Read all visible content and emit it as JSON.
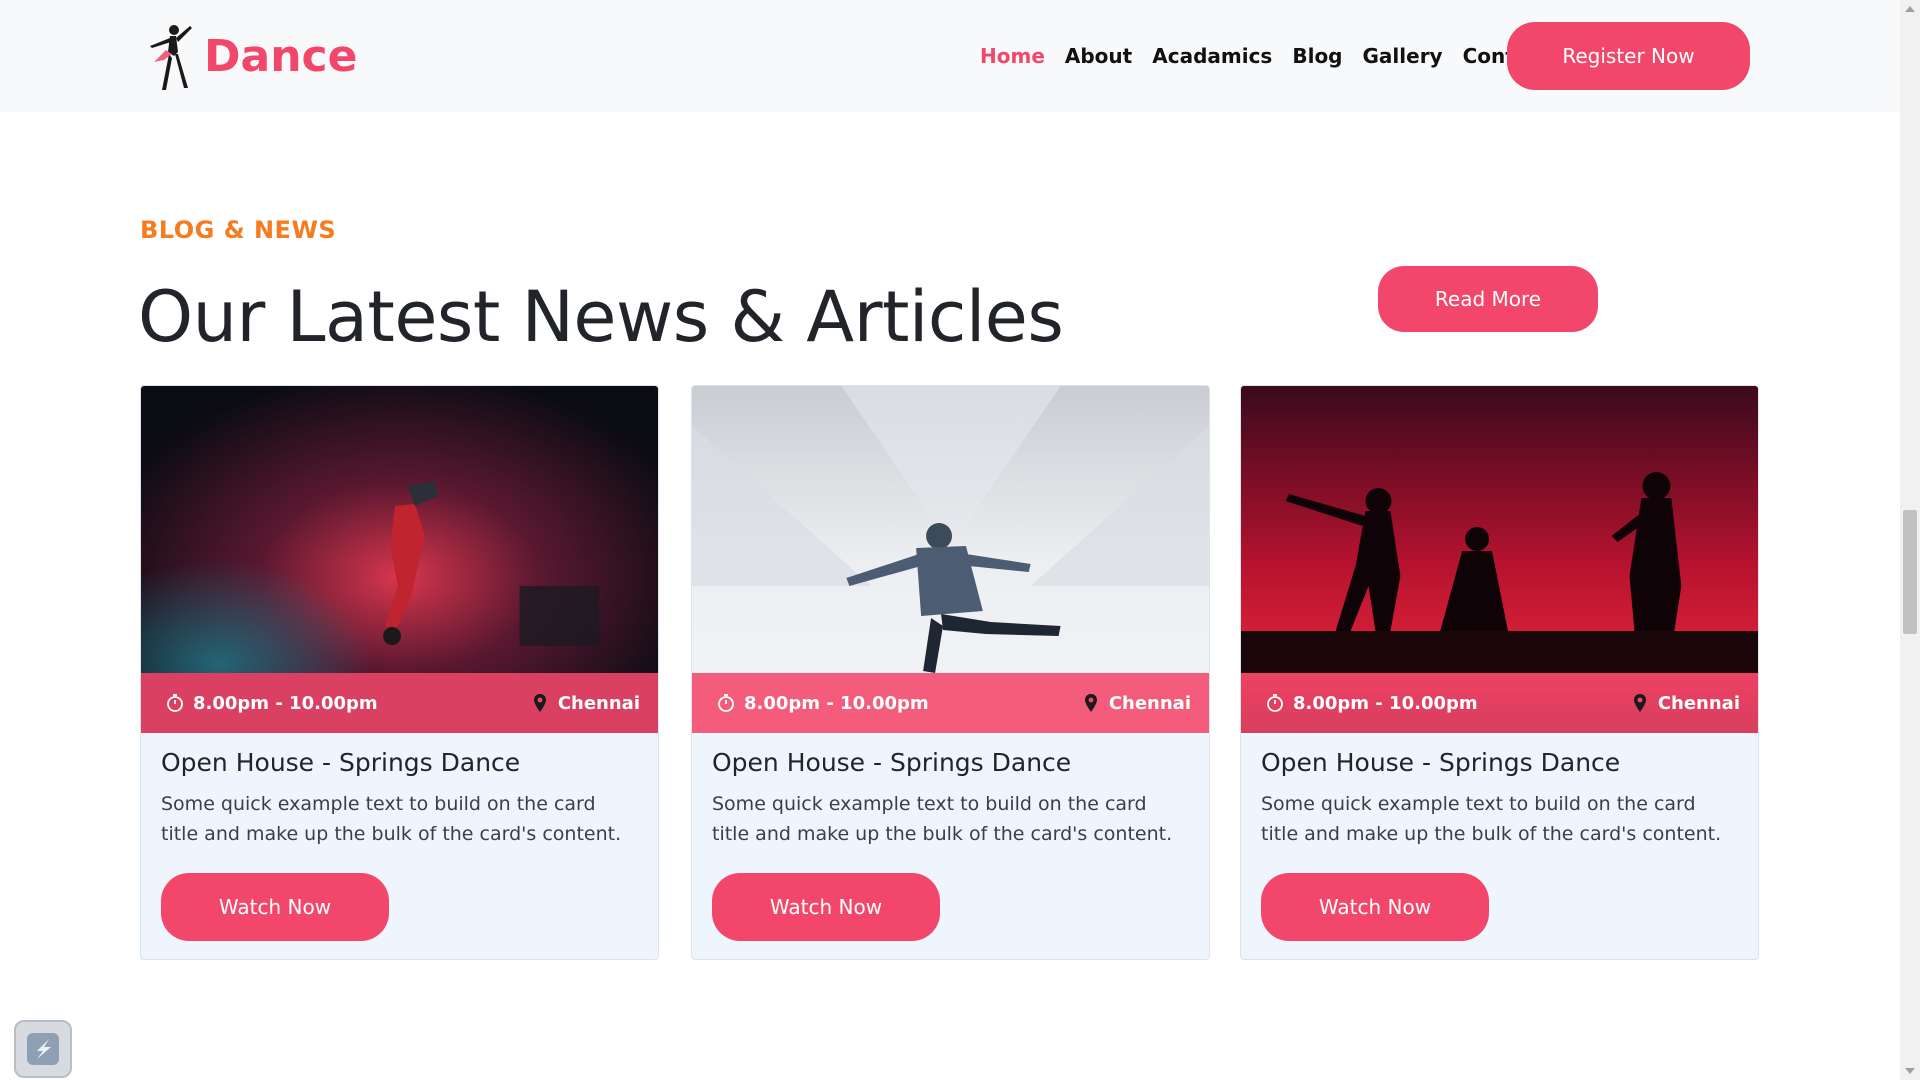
{
  "header": {
    "logo_text": "Dance",
    "nav": [
      "Home",
      "About",
      "Acadamics",
      "Blog",
      "Gallery",
      "Contact"
    ],
    "active_nav": "Home",
    "register_label": "Register Now"
  },
  "section": {
    "eyebrow": "BLOG & NEWS",
    "title": "Our Latest News & Articles",
    "read_more_label": "Read More"
  },
  "cards": [
    {
      "time": "8.00pm - 10.00pm",
      "location": "Chennai",
      "title": "Open House - Springs Dance",
      "text": "Some quick example text to build on the card title and make up the bulk of the card's content.",
      "button": "Watch Now"
    },
    {
      "time": "8.00pm - 10.00pm",
      "location": "Chennai",
      "title": "Open House - Springs Dance",
      "text": "Some quick example text to build on the card title and make up the bulk of the card's content.",
      "button": "Watch Now"
    },
    {
      "time": "8.00pm - 10.00pm",
      "location": "Chennai",
      "title": "Open House - Springs Dance",
      "text": "Some quick example text to build on the card title and make up the bulk of the card's content.",
      "button": "Watch Now"
    }
  ],
  "icons": {
    "time": "stopwatch-icon",
    "location": "map-pin-icon",
    "widget": "app-widget-icon"
  },
  "colors": {
    "accent": "#f2476a",
    "eyebrow": "#f57c1f",
    "header_bg": "#f8f9fa",
    "card_bg": "#eef5fc"
  }
}
